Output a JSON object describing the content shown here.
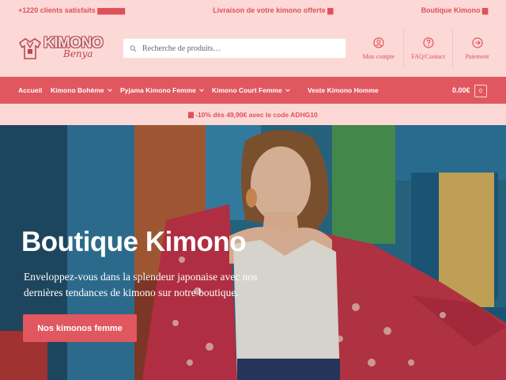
{
  "topbar": {
    "left": "+1220 clients satisfaits",
    "center": "Livraison de votre kimono offerte",
    "right": "Boutique Kimono",
    "icon_names": [
      "emoji-glyph",
      "emoji-glyph"
    ]
  },
  "logo": {
    "title": "KIMONO",
    "script": "Benya"
  },
  "search": {
    "placeholder": "Recherche de produits…"
  },
  "account": {
    "items": [
      {
        "label": "Mon compte",
        "icon": "user-icon"
      },
      {
        "label": "FAQ/Contact",
        "icon": "help-icon"
      },
      {
        "label": "Paiement",
        "icon": "arrow-right-circle-icon"
      }
    ]
  },
  "nav": {
    "items": [
      {
        "label": "Accueil",
        "dropdown": false
      },
      {
        "label": "Kimono Bohème",
        "dropdown": true
      },
      {
        "label": "Pyjama Kimono Femme",
        "dropdown": true
      },
      {
        "label": "Kimono Court Femme",
        "dropdown": true
      },
      {
        "label": "Veste Kimono Homme",
        "dropdown": false
      }
    ],
    "cart_total": "0.00€",
    "cart_count": "0"
  },
  "promo": {
    "text": "-10% dès 49,90€ avec le code ADHG10"
  },
  "hero": {
    "title": "Boutique Kimono",
    "subtitle": "Enveloppez-vous dans la splendeur japonaise avec nos dernières tendances de kimono sur notre boutique.",
    "cta": "Nos kimonos femme"
  },
  "colors": {
    "accent": "#e0575f",
    "background": "#fcd9d6",
    "text_accent": "#e0505a"
  }
}
